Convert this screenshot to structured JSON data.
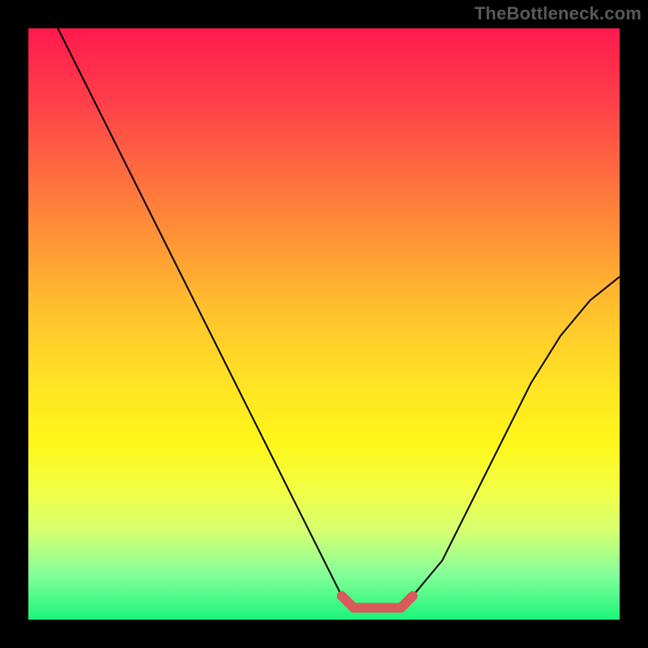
{
  "watermark": "TheBottleneck.com",
  "colors": {
    "frame": "#000000",
    "gradient_top": "#ff1a4d",
    "gradient_bottom": "#1bf57a",
    "curve": "#000000",
    "marker": "#d85a5a"
  },
  "chart_data": {
    "type": "line",
    "title": "",
    "xlabel": "",
    "ylabel": "",
    "xlim": [
      0,
      100
    ],
    "ylim": [
      0,
      100
    ],
    "annotations": [],
    "series": [
      {
        "name": "curve",
        "x": [
          5,
          10,
          15,
          20,
          25,
          30,
          35,
          40,
          45,
          50,
          53,
          55,
          58,
          60,
          63,
          65,
          70,
          75,
          80,
          85,
          90,
          95,
          100
        ],
        "y": [
          100,
          90,
          80,
          70,
          60,
          50,
          40,
          30,
          20,
          10,
          4,
          2,
          2,
          2,
          2,
          4,
          10,
          20,
          30,
          40,
          48,
          54,
          58
        ]
      },
      {
        "name": "minimum-marker",
        "x": [
          53,
          55,
          58,
          60,
          63,
          65
        ],
        "y": [
          4,
          2,
          2,
          2,
          2,
          4
        ]
      }
    ]
  }
}
